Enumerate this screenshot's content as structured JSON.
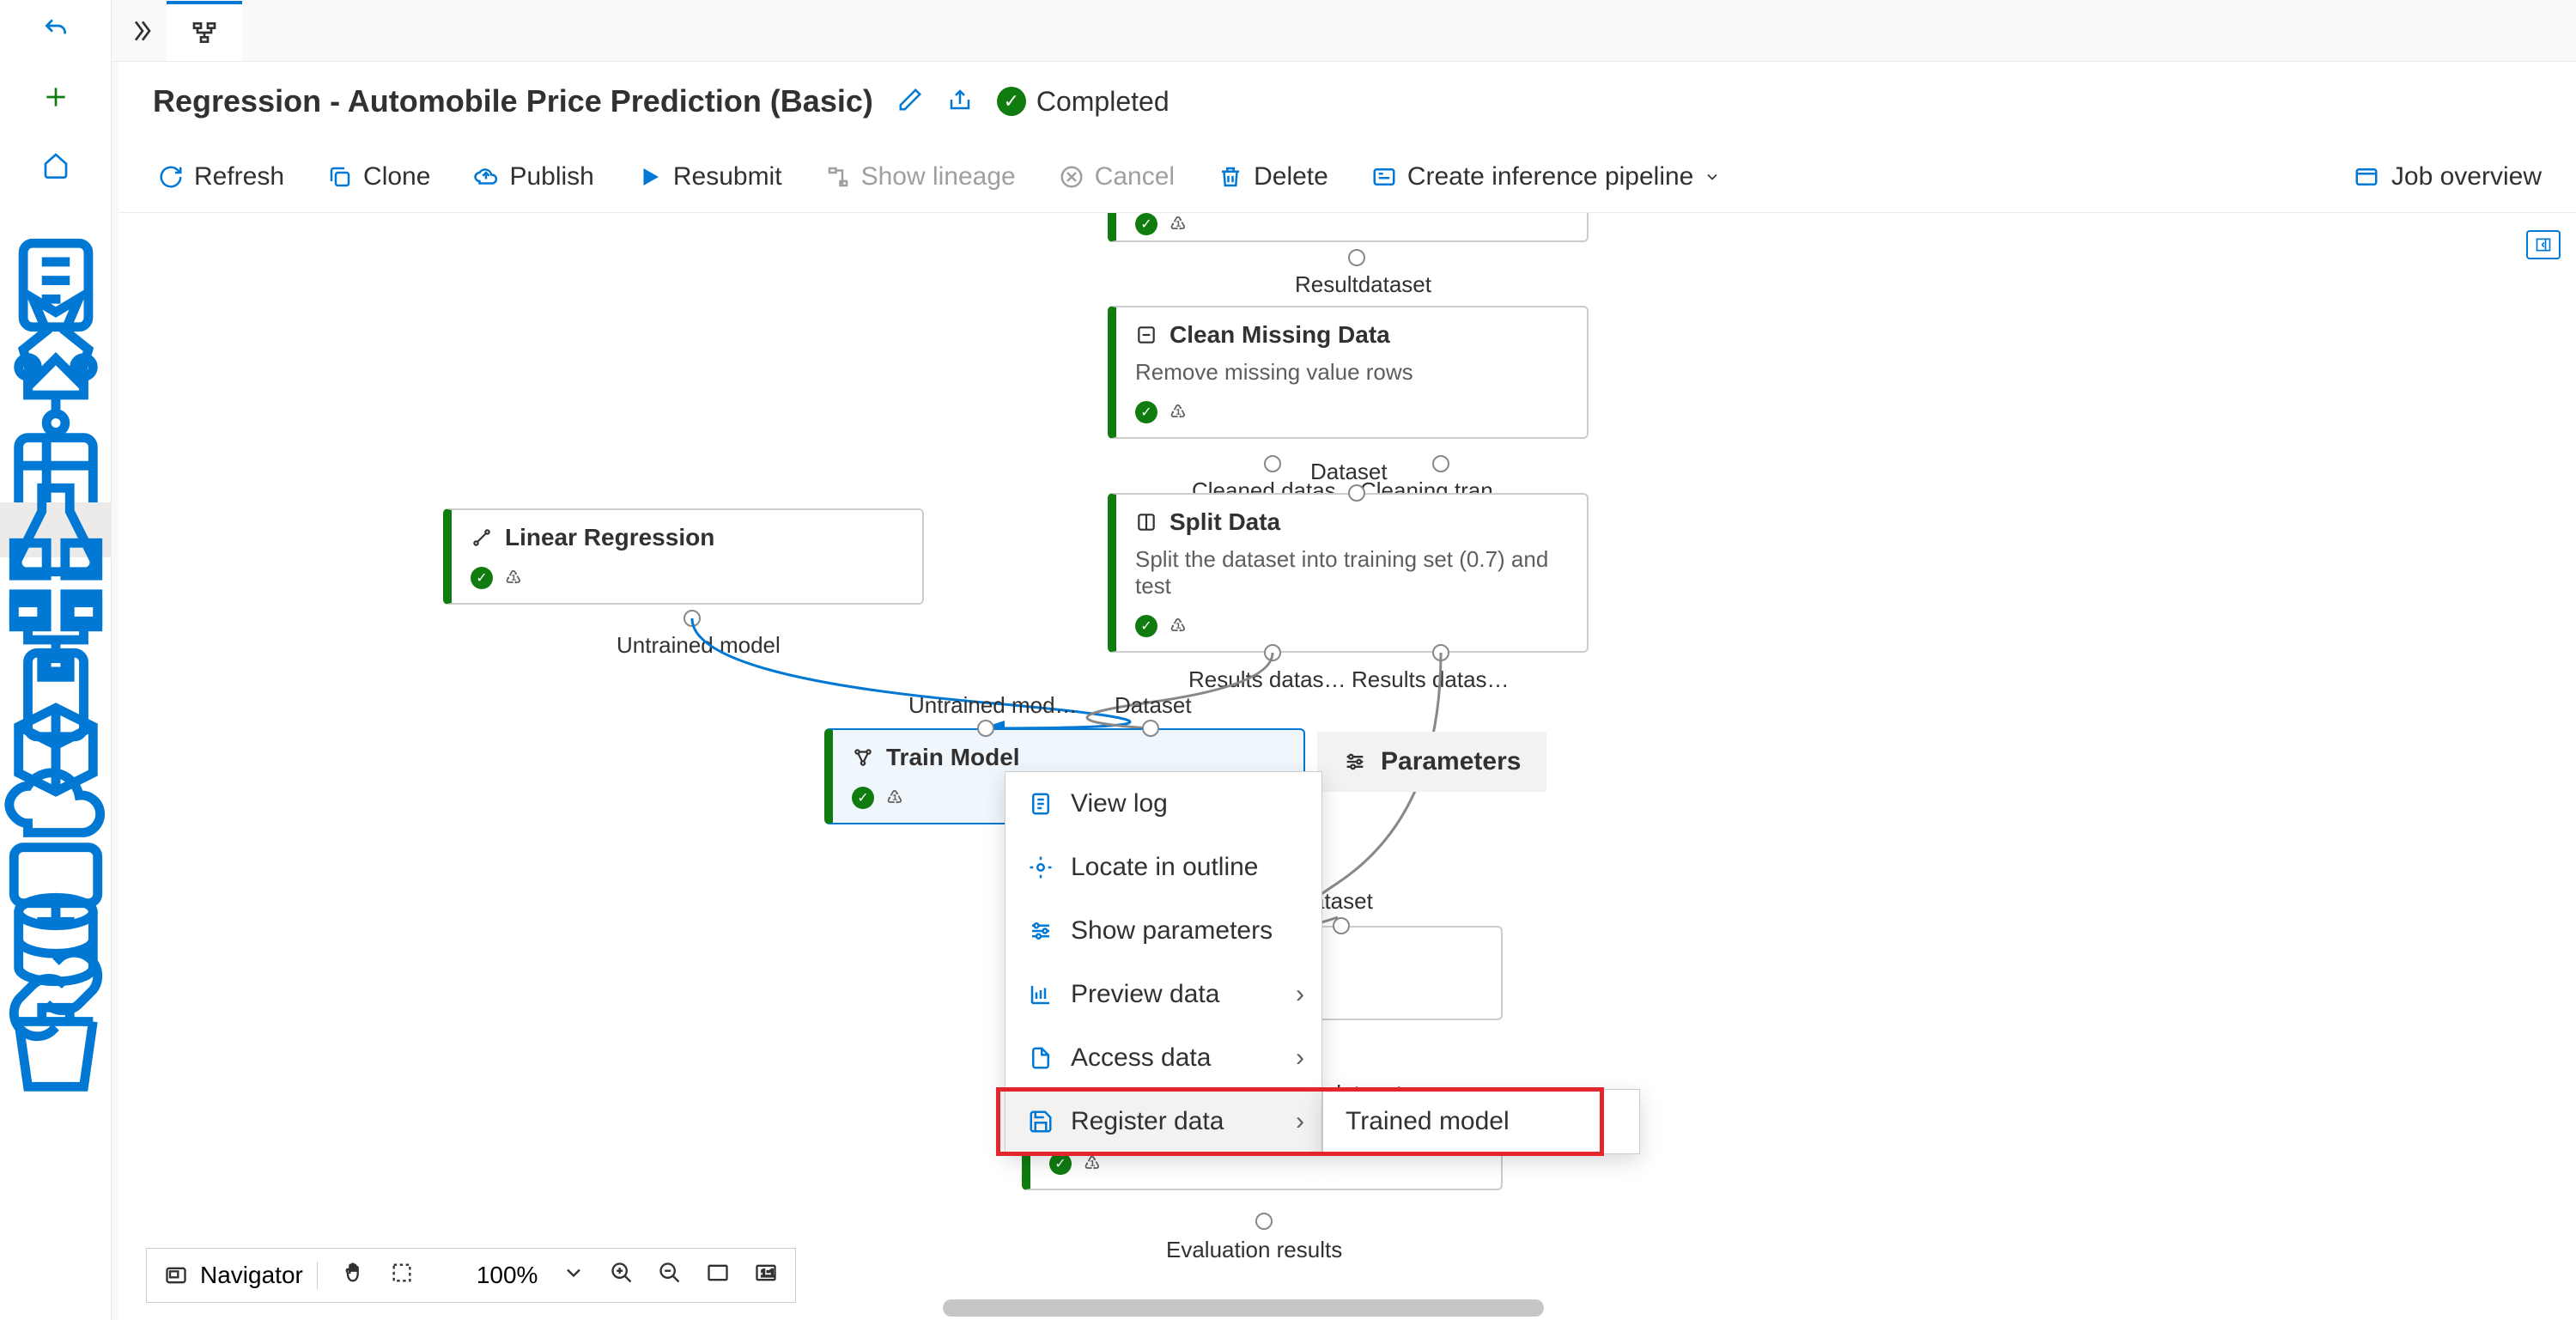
{
  "pipeline": {
    "title": "Regression - Automobile Price Prediction (Basic)",
    "status": "Completed"
  },
  "toolbar": {
    "refresh": "Refresh",
    "clone": "Clone",
    "publish": "Publish",
    "resubmit": "Resubmit",
    "show_lineage": "Show lineage",
    "cancel": "Cancel",
    "delete": "Delete",
    "create_inference": "Create inference pipeline",
    "job_overview": "Job overview"
  },
  "nodes": {
    "clean_missing": {
      "title": "Clean Missing Data",
      "subtitle": "Remove missing value rows",
      "in_label": "Resultdataset",
      "out1": "Cleaned datas…",
      "out2": "Cleaning tran…"
    },
    "linear_regression": {
      "title": "Linear Regression",
      "out": "Untrained model"
    },
    "split_data": {
      "title": "Split Data",
      "subtitle": "Split the dataset into training set (0.7) and test",
      "in": "Dataset",
      "out1": "Results datas…",
      "out2": "Results datas…"
    },
    "train_model": {
      "title": "Train Model",
      "in1": "Untrained mod…",
      "in2": "Dataset"
    },
    "score_hidden": {
      "in_label": "ataset",
      "out_label": "d dataset"
    },
    "evaluate": {
      "out": "Evaluation results"
    }
  },
  "context_menu": {
    "view_log": "View log",
    "locate": "Locate in outline",
    "show_params": "Show parameters",
    "preview": "Preview data",
    "access": "Access data",
    "register": "Register data"
  },
  "submenu": {
    "trained_model": "Trained model"
  },
  "params_panel": "Parameters",
  "bottom_bar": {
    "navigator": "Navigator",
    "zoom": "100%"
  }
}
